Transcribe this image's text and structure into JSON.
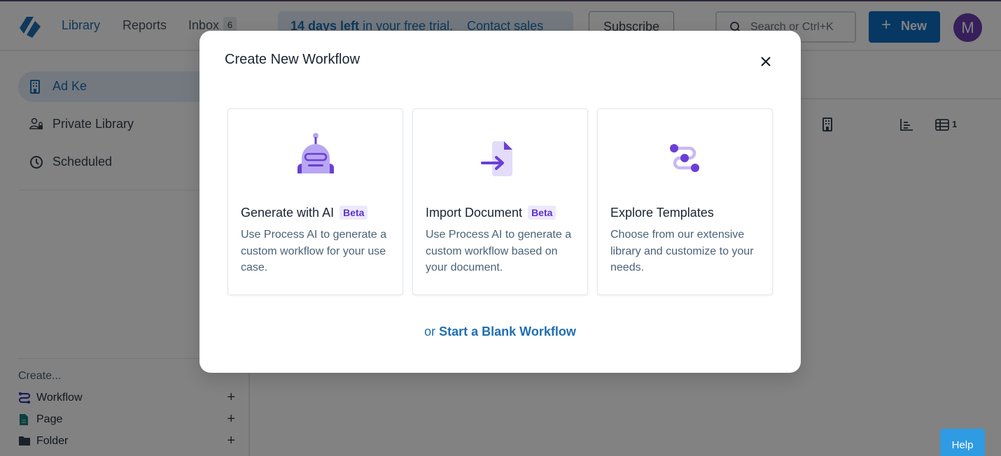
{
  "topbar": {
    "nav": [
      {
        "label": "Library",
        "active": true
      },
      {
        "label": "Reports",
        "active": false
      },
      {
        "label": "Inbox",
        "active": false
      }
    ],
    "inbox_count": "6",
    "trial_banner": {
      "days_left": "14 days left",
      "message": " in your free trial.",
      "contact": "Contact sales"
    },
    "subscribe_label": "Subscribe",
    "search_placeholder": "Search or Ctrl+K",
    "new_label": "New",
    "avatar_initial": "M"
  },
  "sidebar": {
    "items": [
      {
        "label": "Ad Ke",
        "icon": "building-icon",
        "active": true
      },
      {
        "label": "Private Library",
        "icon": "private-user-icon",
        "active": false
      },
      {
        "label": "Scheduled",
        "icon": "clock-icon",
        "active": false
      }
    ],
    "create_label": "Create...",
    "create_items": [
      {
        "label": "Workflow",
        "icon": "workflow-icon"
      },
      {
        "label": "Page",
        "icon": "page-icon"
      },
      {
        "label": "Folder",
        "icon": "folder-icon"
      }
    ],
    "add_symbol": "+"
  },
  "main": {
    "table_count": "1"
  },
  "modal": {
    "title": "Create New Workflow",
    "cards": [
      {
        "title": "Generate with AI",
        "badge": "Beta",
        "description": "Use Process AI to generate a custom workflow for your use case.",
        "icon": "robot-icon"
      },
      {
        "title": "Import Document",
        "badge": "Beta",
        "description": "Use Process AI to generate a custom workflow based on your document.",
        "icon": "import-document-icon"
      },
      {
        "title": "Explore Templates",
        "badge": "",
        "description": "Choose from our extensive library and customize to your needs.",
        "icon": "templates-icon"
      }
    ],
    "blank_prefix": "or ",
    "blank_link": "Start a Blank Workflow"
  },
  "help_label": "Help",
  "colors": {
    "brand_blue": "#1f6fb2",
    "primary_button": "#0d6ec2",
    "accent_purple": "#6a3fd6",
    "light_purple": "#b9a6f2",
    "avatar": "#6d3db5",
    "help_button": "#2f9be3"
  }
}
